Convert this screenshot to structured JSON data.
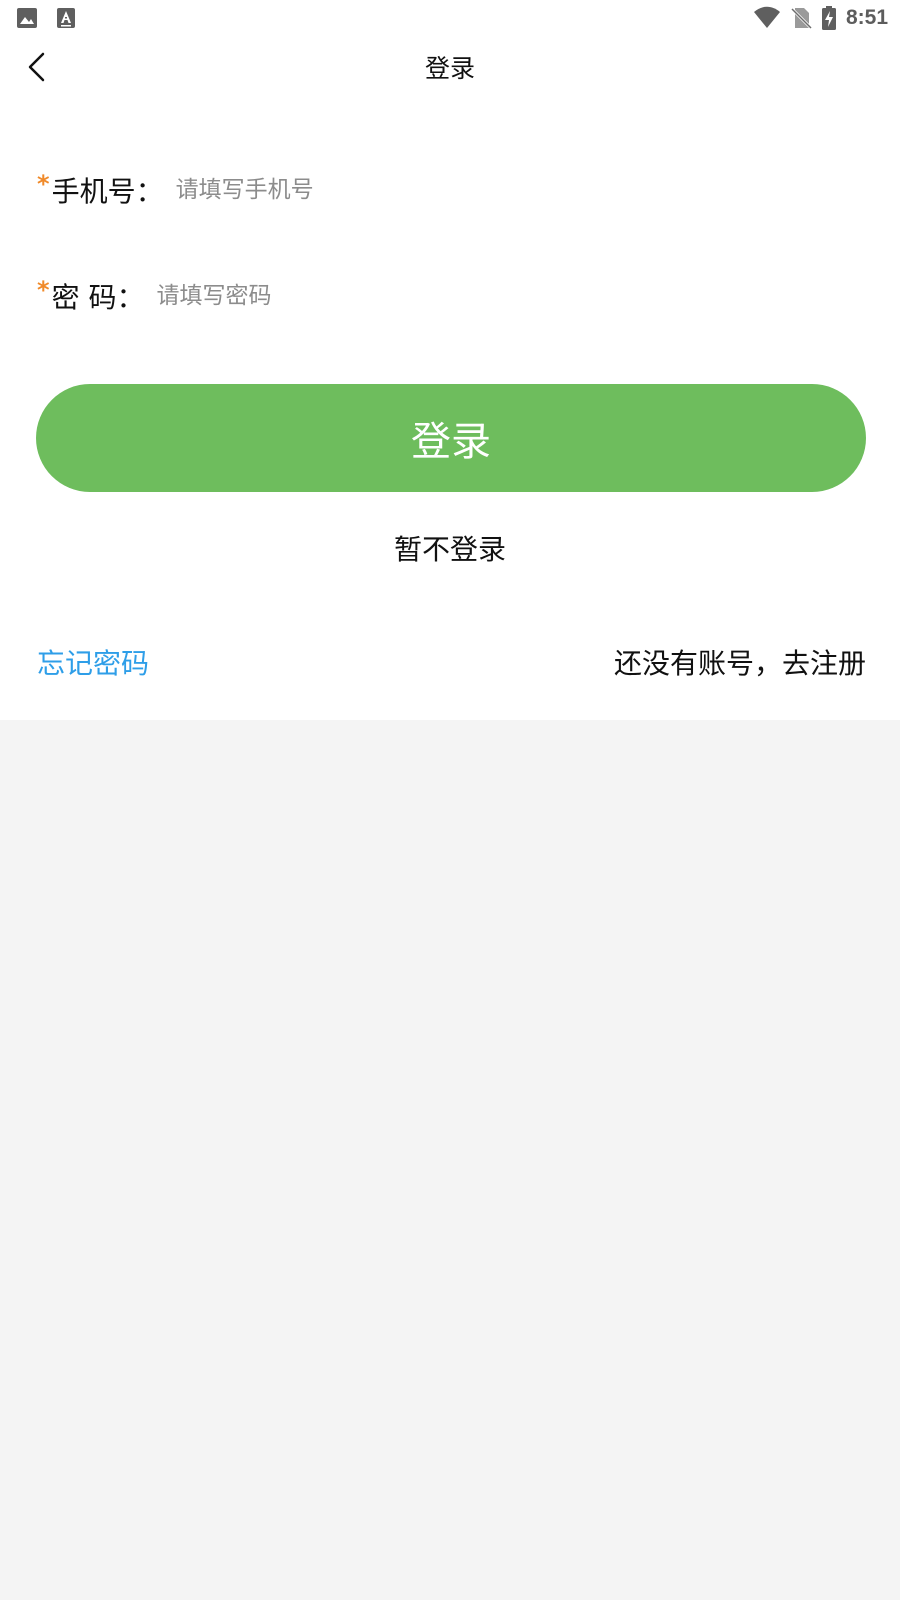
{
  "status_bar": {
    "time": "8:51",
    "left_icons": [
      "image-icon",
      "text-font-icon"
    ],
    "right_icons": [
      "wifi-icon",
      "no-sim-icon",
      "battery-charging-icon"
    ]
  },
  "header": {
    "title": "登录",
    "back_icon": "chevron-left-icon"
  },
  "form": {
    "phone": {
      "required_mark": "*",
      "label": "手机号：",
      "placeholder": "请填写手机号",
      "value": ""
    },
    "password": {
      "required_mark": "*",
      "label": "密 码：",
      "placeholder": "请填写密码",
      "value": ""
    }
  },
  "actions": {
    "login_label": "登录",
    "skip_label": "暂不登录",
    "forgot_label": "忘记密码",
    "register_label": "还没有账号，去注册"
  },
  "colors": {
    "accent_green": "#6ebd5d",
    "link_blue": "#2e9ee8",
    "required_orange": "#f08a2a",
    "page_background": "#f4f4f4"
  }
}
